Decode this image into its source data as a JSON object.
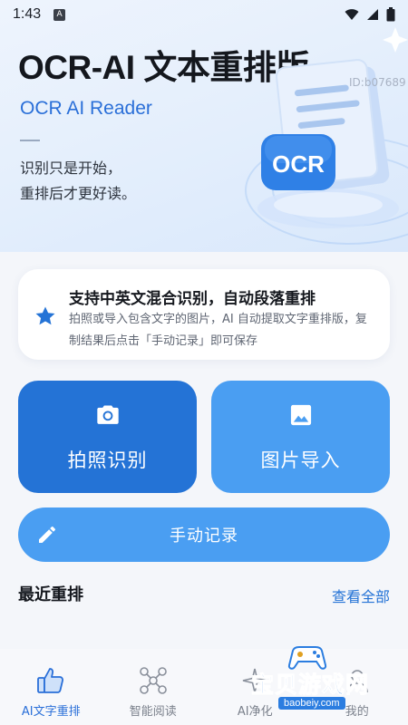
{
  "status_bar": {
    "time": "1:43",
    "notif_letter": "A"
  },
  "hero": {
    "title": "OCR-AI 文本重排版",
    "subtitle": "OCR AI Reader",
    "slogan_line1": "识别只是开始，",
    "slogan_line2": "重排后才更好读。",
    "id_text": "ID:b07689",
    "badge_text": "OCR"
  },
  "feature": {
    "title": "支持中英文混合识别，自动段落重排",
    "description": "拍照或导入包含文字的图片，AI 自动提取文字重排版，复制结果后点击「手动记录」即可保存",
    "icon": "star-icon"
  },
  "actions": {
    "camera_label": "拍照识别",
    "image_label": "图片导入",
    "manual_label": "手动记录"
  },
  "recent": {
    "title": "最近重排",
    "view_all": "查看全部"
  },
  "nav": [
    {
      "label": "AI文字重排",
      "icon": "thumbs-up-icon"
    },
    {
      "label": "智能阅读",
      "icon": "molecule-icon"
    },
    {
      "label": "AI净化",
      "icon": "sparkle-icon"
    },
    {
      "label": "我的",
      "icon": "user-icon"
    }
  ],
  "watermark": {
    "text": "宝贝游戏网",
    "url": "baobeiy.com"
  },
  "colors": {
    "primary": "#2473d6",
    "secondary": "#4a9ef2",
    "accent_text": "#2a6fd8"
  }
}
